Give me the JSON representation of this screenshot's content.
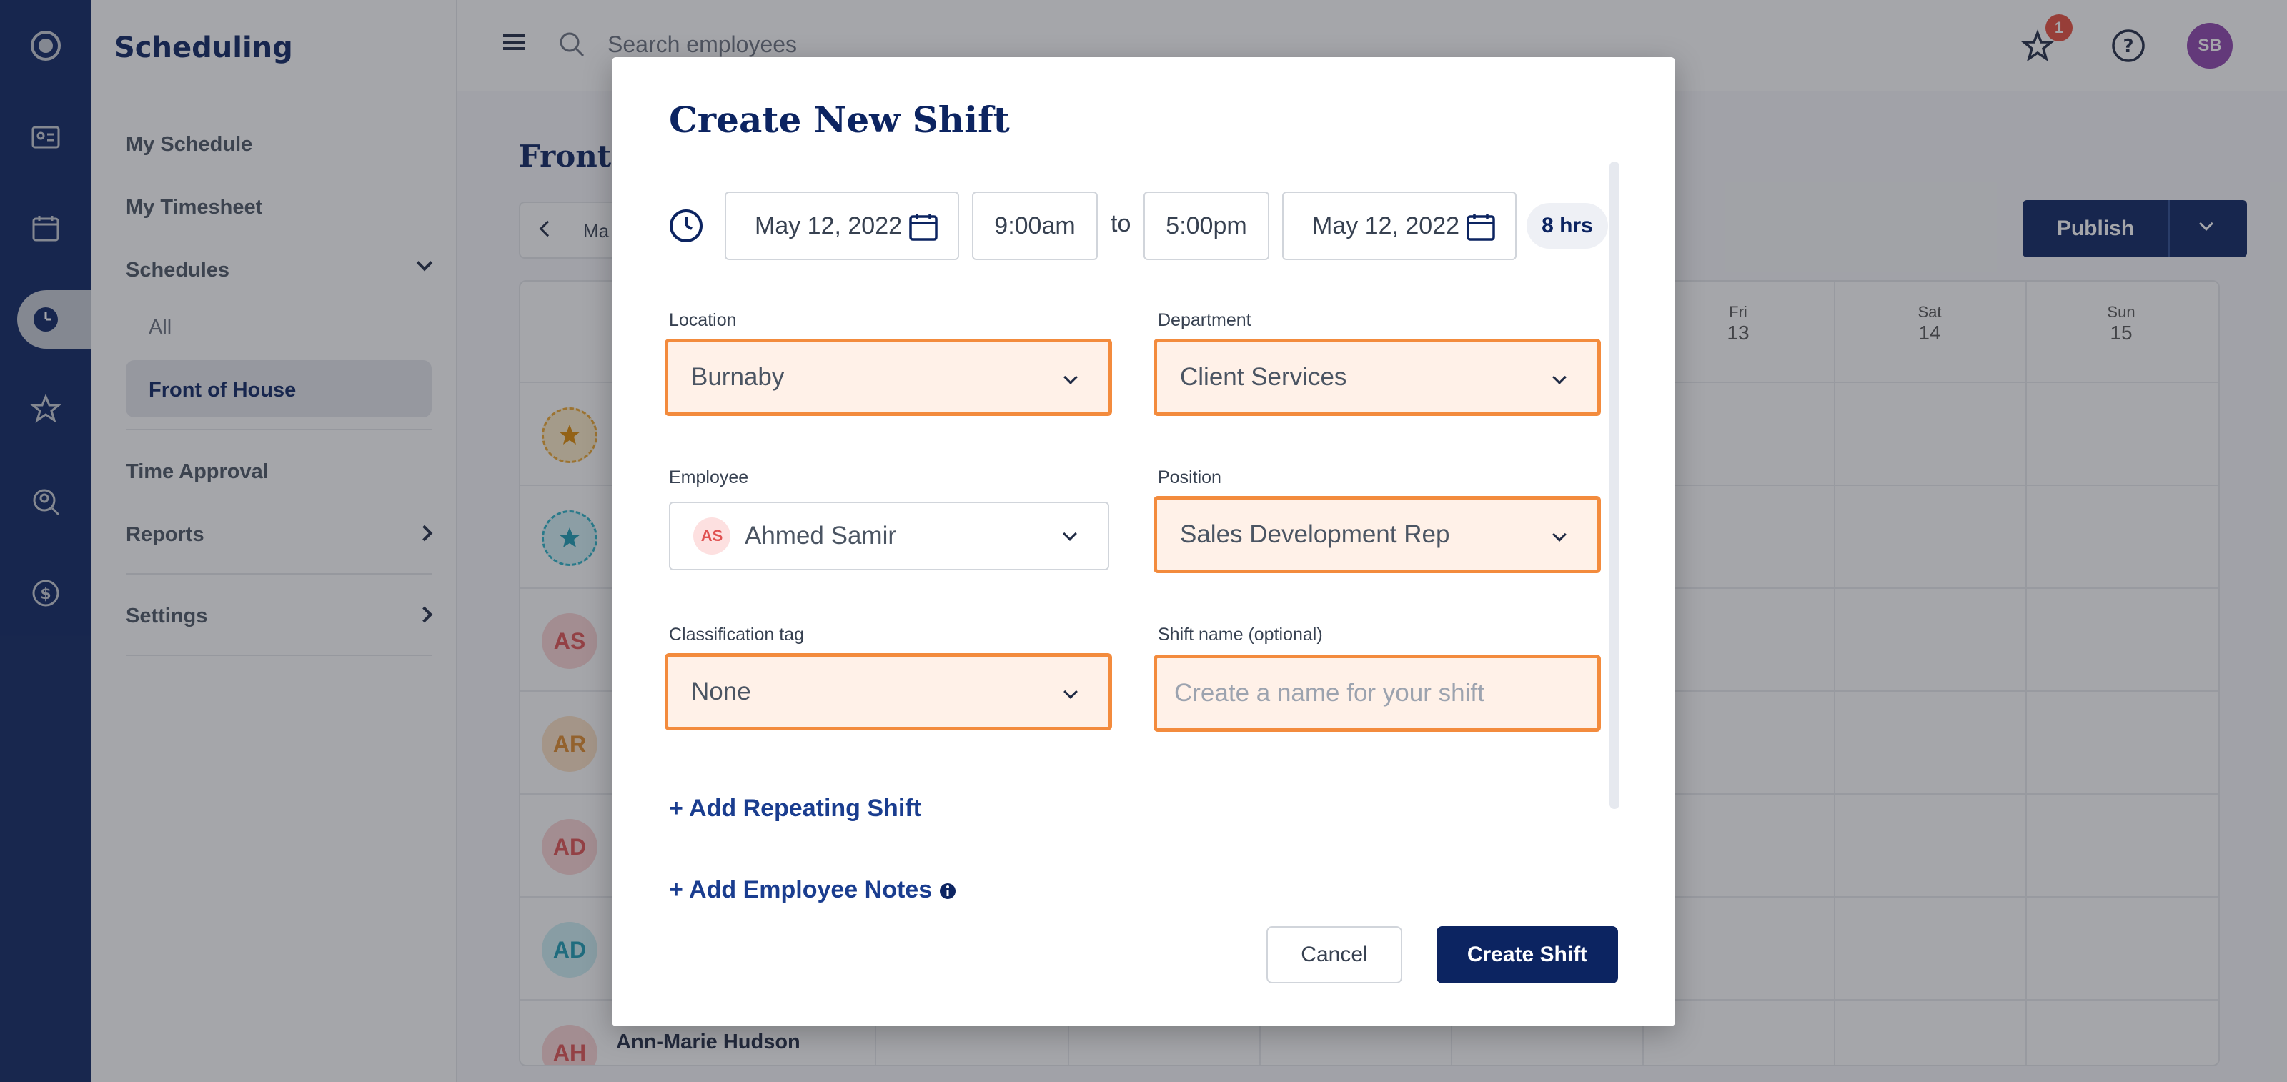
{
  "sidebar": {
    "title": "Scheduling",
    "items": [
      {
        "label": "My Schedule"
      },
      {
        "label": "My Timesheet"
      },
      {
        "label": "Schedules"
      },
      {
        "label": "All"
      },
      {
        "label": "Front of House"
      },
      {
        "label": "Time Approval"
      },
      {
        "label": "Reports"
      },
      {
        "label": "Settings"
      }
    ]
  },
  "topbar": {
    "search_placeholder": "Search employees",
    "notification_count": "1",
    "user_initials": "SB"
  },
  "main": {
    "title": "Front",
    "date_nav_label": "Ma",
    "publish_label": "Publish",
    "days": [
      {
        "name": "Fri",
        "num": "13"
      },
      {
        "name": "Sat",
        "num": "14"
      },
      {
        "name": "Sun",
        "num": "15"
      }
    ],
    "rows": [
      {
        "initials": "AS"
      },
      {
        "initials": "AR"
      },
      {
        "initials": "AD"
      },
      {
        "initials": "AD"
      },
      {
        "initials": "AH",
        "name": "Ann-Marie Hudson"
      }
    ]
  },
  "modal": {
    "title": "Create New Shift",
    "start_date": "May 12, 2022",
    "start_time": "9:00am",
    "to_label": "to",
    "end_time": "5:00pm",
    "end_date": "May 12, 2022",
    "duration": "8 hrs",
    "location_label": "Location",
    "location_value": "Burnaby",
    "department_label": "Department",
    "department_value": "Client Services",
    "employee_label": "Employee",
    "employee_initials": "AS",
    "employee_value": "Ahmed Samir",
    "position_label": "Position",
    "position_value": "Sales Development Rep",
    "classification_label": "Classification tag",
    "classification_value": "None",
    "shift_name_label": "Shift name (optional)",
    "shift_name_placeholder": "Create a name for your shift",
    "add_repeating": "+ Add Repeating Shift",
    "add_notes": "+ Add Employee Notes",
    "cancel_label": "Cancel",
    "create_label": "Create Shift"
  },
  "colors": {
    "brand": "#0c2461",
    "highlight_border": "#f38b3d",
    "highlight_fill": "#fff1e8"
  }
}
